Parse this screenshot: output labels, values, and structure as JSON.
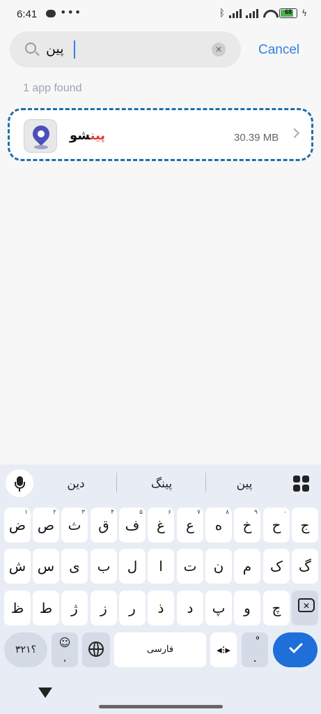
{
  "status": {
    "time": "6:41",
    "dots": "•••",
    "battery": "68"
  },
  "search": {
    "query": "پین",
    "clear_icon": "✕",
    "cancel_label": "Cancel"
  },
  "results": {
    "count_text": "1 app found",
    "items": [
      {
        "name_highlight": "پین",
        "name_rest": "شو",
        "size": "30.39 MB"
      }
    ]
  },
  "keyboard": {
    "suggestions": [
      "دین",
      "پینگ",
      "پین"
    ],
    "row1": [
      {
        "label": "ض",
        "hint": "۱"
      },
      {
        "label": "ص",
        "hint": "۲"
      },
      {
        "label": "ث",
        "hint": "۳"
      },
      {
        "label": "ق",
        "hint": "۴"
      },
      {
        "label": "ف",
        "hint": "۵"
      },
      {
        "label": "غ",
        "hint": "۶"
      },
      {
        "label": "ع",
        "hint": "۷"
      },
      {
        "label": "ه",
        "hint": "۸"
      },
      {
        "label": "خ",
        "hint": "۹"
      },
      {
        "label": "ح",
        "hint": "۰"
      },
      {
        "label": "ج",
        "hint": ""
      }
    ],
    "row2": [
      "ش",
      "س",
      "ی",
      "ب",
      "ل",
      "ا",
      "ت",
      "ن",
      "م",
      "ک",
      "گ"
    ],
    "row3": [
      "ظ",
      "ط",
      "ژ",
      "ز",
      "ر",
      "ذ",
      "د",
      "پ",
      "و",
      "چ"
    ],
    "symbols_label": "؟۳۲۱",
    "emoji_key": "☺",
    "emoji_sub": "،",
    "space_label": "فارسی",
    "cursor_key": "◂⁝▸",
    "period_key": "ْ",
    "period_sub": "."
  }
}
